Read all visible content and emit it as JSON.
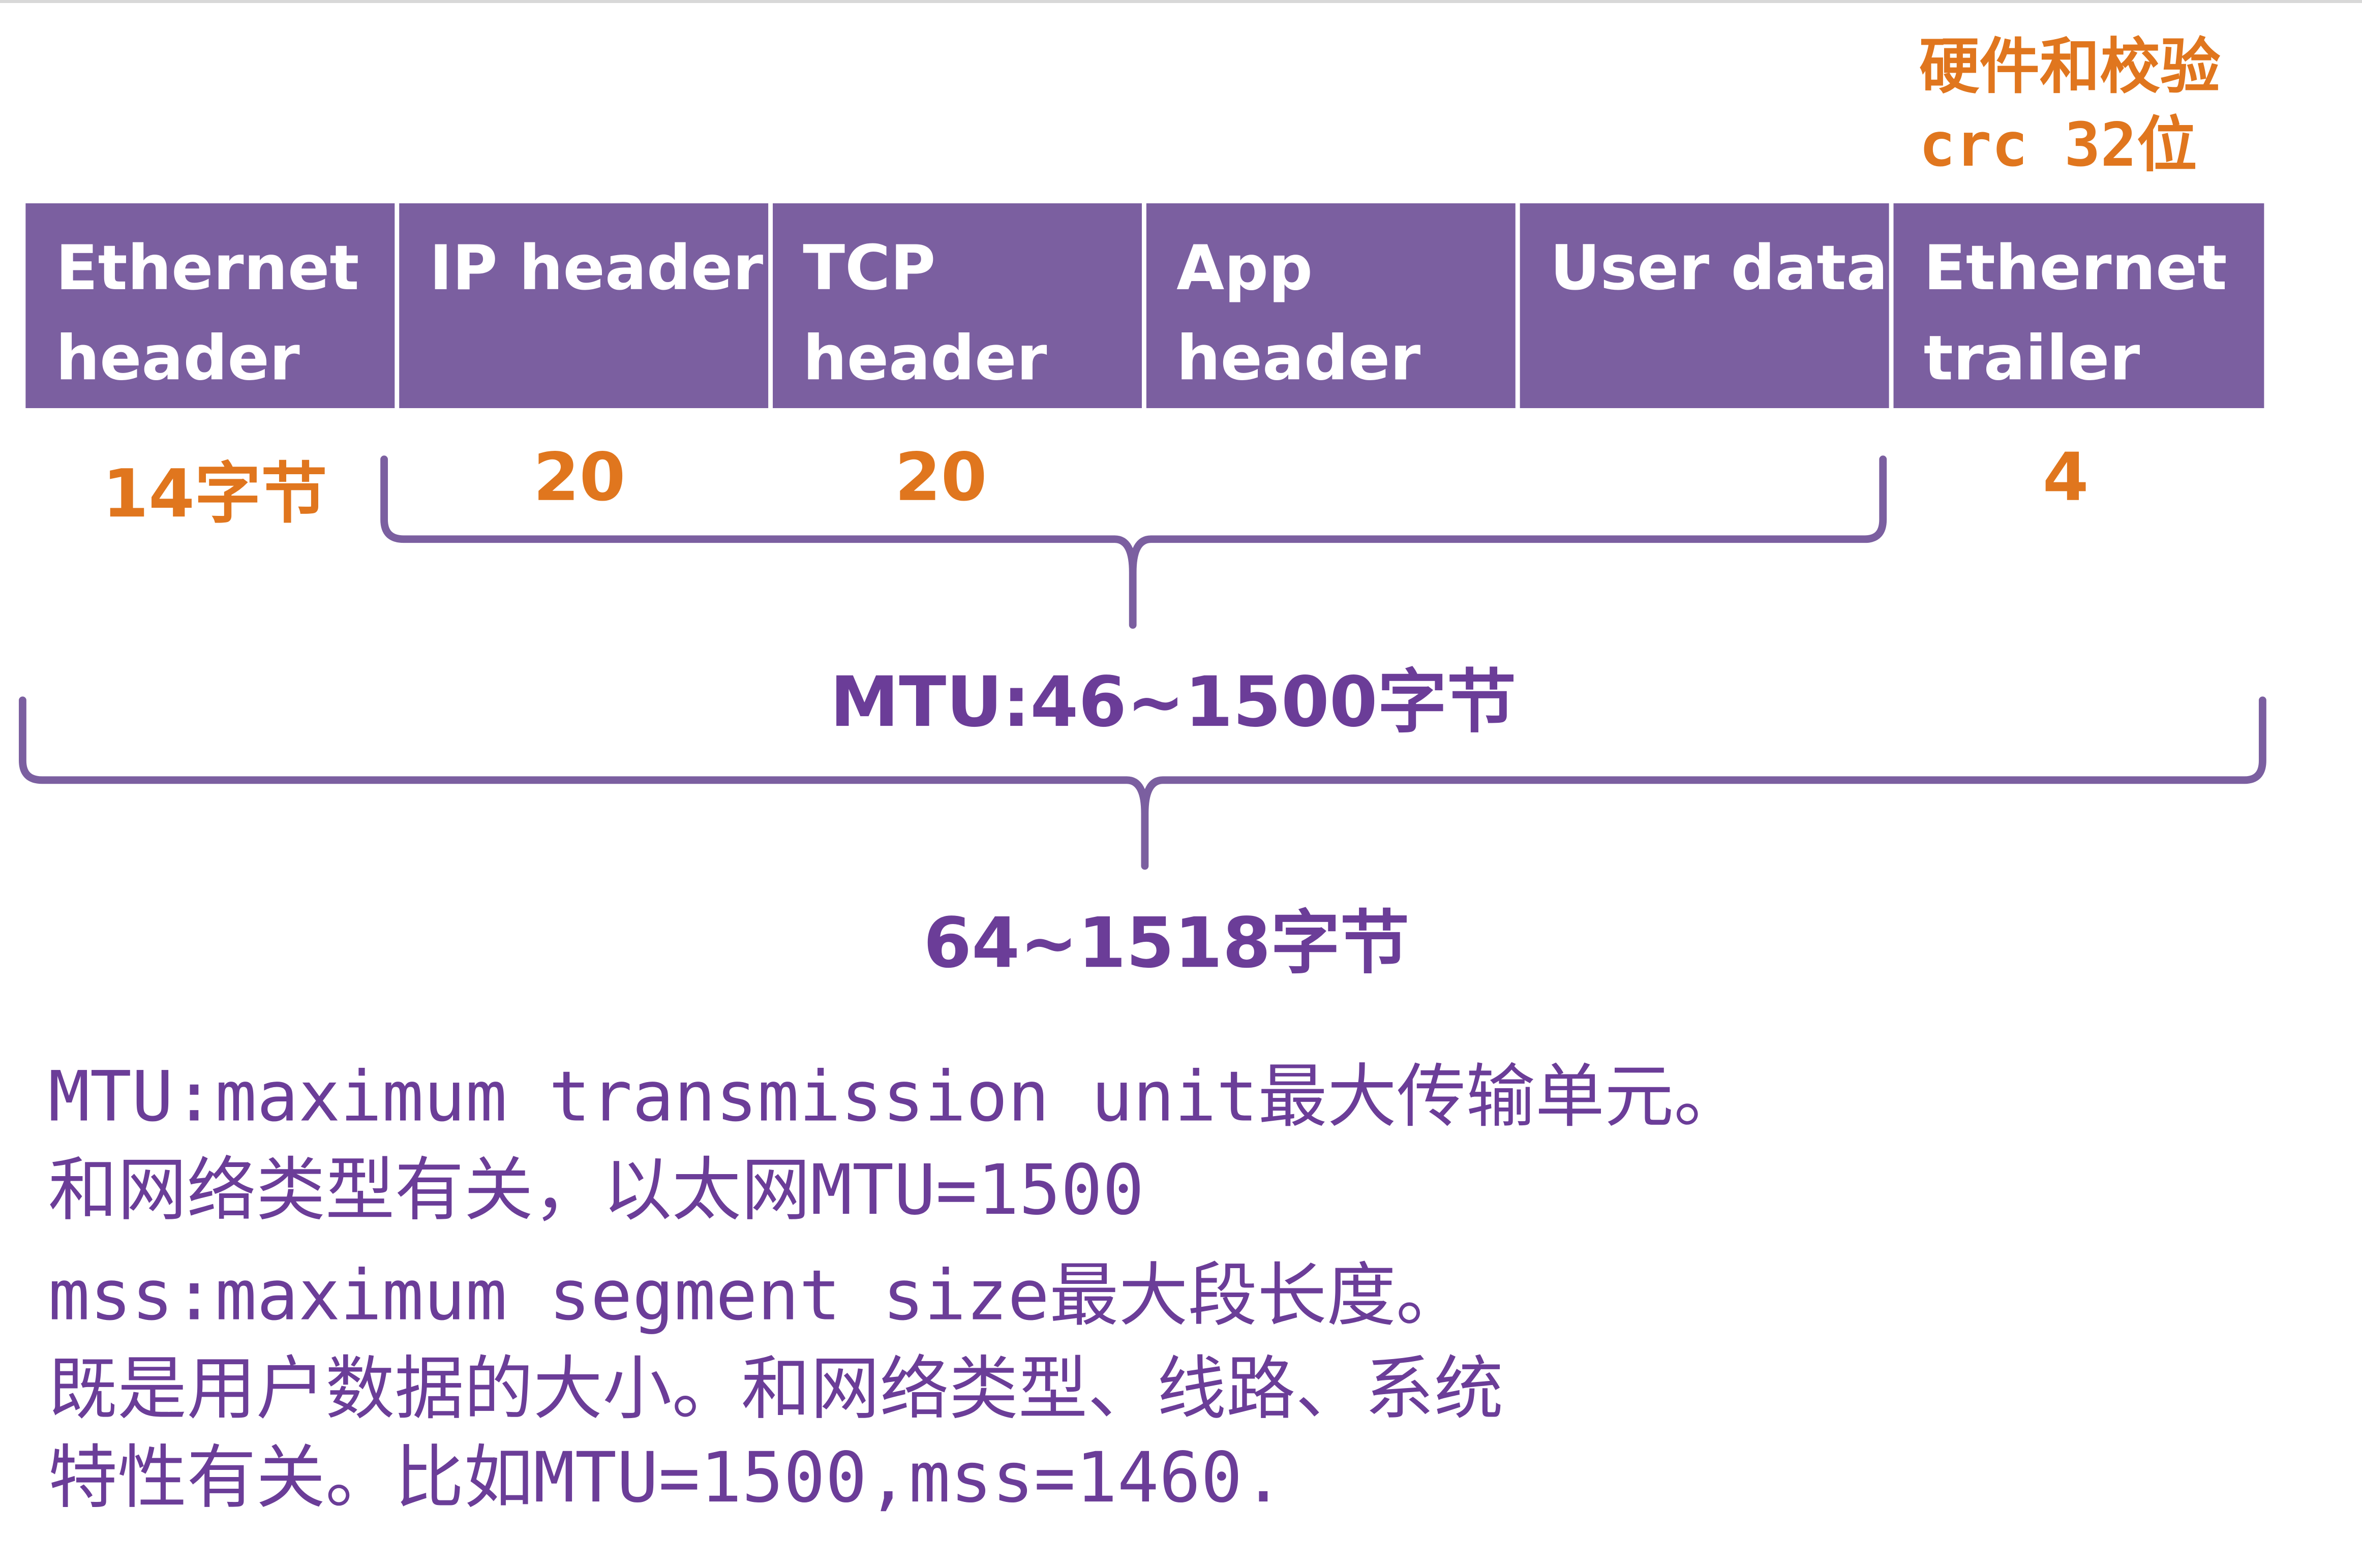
{
  "crc_note": {
    "line1": "硬件和校验",
    "line2": "crc 32位"
  },
  "segments": [
    {
      "label": "Ethernet\nheader"
    },
    {
      "label": "IP header"
    },
    {
      "label": "TCP\nheader"
    },
    {
      "label": "App\nheader"
    },
    {
      "label": "User data"
    },
    {
      "label": "Ethernet\ntrailer"
    }
  ],
  "sizes": {
    "ethernet_header": "14字节",
    "ip_header": "20",
    "tcp_header": "20",
    "ethernet_trailer": "4"
  },
  "mtu_label": "MTU:46~1500字节",
  "frame_label": "64~1518字节",
  "notes": {
    "line1": "MTU:maximum transmission unit最大传输单元。",
    "line2": "和网络类型有关，以太网MTU=1500",
    "line3": "mss:maximum segment size最大段长度。",
    "line4": "既是用户数据的大小。和网络类型、线路、系统",
    "line5": "特性有关。比如MTU=1500,mss=1460."
  },
  "colors": {
    "segment_fill": "#7b5fa0",
    "size_text": "#e0761e",
    "label_text": "#6b3d98",
    "brace": "#7b5fa0"
  }
}
